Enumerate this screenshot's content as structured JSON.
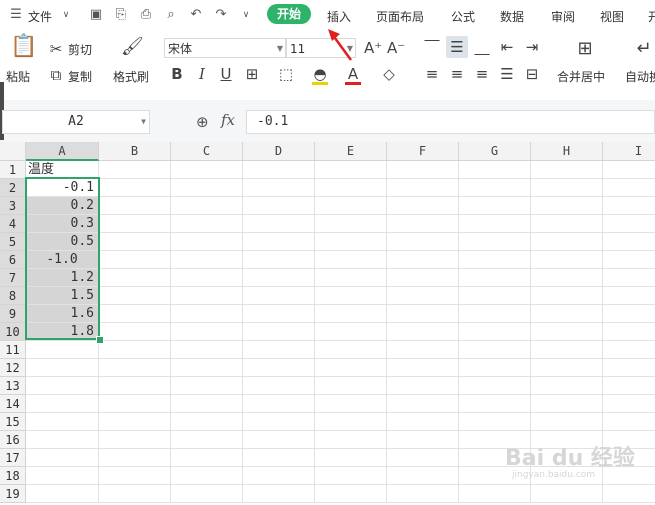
{
  "menubar": {
    "file_label": "文件",
    "tabs": [
      "开始",
      "插入",
      "页面布局",
      "公式",
      "数据",
      "审阅",
      "视图",
      "开"
    ]
  },
  "ribbon": {
    "cut": "剪切",
    "paste": "粘贴",
    "copy": "复制",
    "format_painter": "格式刷",
    "font_name": "宋体",
    "font_size": "11",
    "merge_center": "合并居中",
    "auto_wrap": "自动换"
  },
  "formula_bar": {
    "cell_ref": "A2",
    "fx": "fx",
    "content": "-0.1"
  },
  "grid": {
    "columns": [
      "A",
      "B",
      "C",
      "D",
      "E",
      "F",
      "G",
      "H",
      "I"
    ],
    "rows": [
      "1",
      "2",
      "3",
      "4",
      "5",
      "6",
      "7",
      "8",
      "9",
      "10",
      "11",
      "12",
      "13",
      "14",
      "15",
      "16",
      "17",
      "18",
      "19"
    ],
    "header_cell": "温度",
    "values": [
      "-0.1",
      "0.2",
      "0.3",
      "0.5",
      "-1.0",
      "1.2",
      "1.5",
      "1.6",
      "1.8"
    ]
  },
  "colors": {
    "accent": "#2fb36b",
    "selection": "#2ea36a",
    "arrow": "#e02020"
  },
  "watermark": {
    "main": "Bai du 经验",
    "sub": "jingyan.baidu.com"
  }
}
